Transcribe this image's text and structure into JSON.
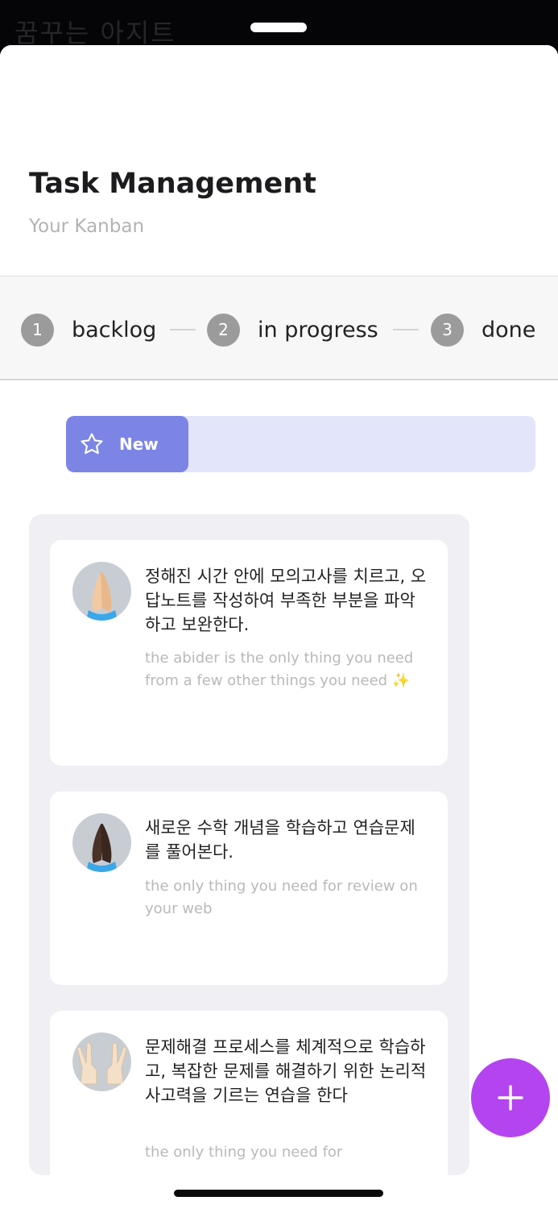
{
  "background": {
    "title": "꿈꾸는 아지트"
  },
  "header": {
    "title": "Task Management",
    "subtitle": "Your Kanban"
  },
  "stepper": {
    "steps": [
      {
        "number": "1",
        "label": "backlog"
      },
      {
        "number": "2",
        "label": "in progress"
      },
      {
        "number": "3",
        "label": "done"
      }
    ]
  },
  "filter": {
    "new_label": "New",
    "icon": "star-icon"
  },
  "cards": [
    {
      "title": "정해진 시간 안에 모의고사를 치르고, 오답노트를 작성하여 부족한 부분을 파악하고 보완한다.",
      "description": "the abider is the only thing you need from a few other things you need ✨",
      "avatar": "praying-hands-emoji"
    },
    {
      "title": "새로운 수학 개념을 학습하고 연습문제를 풀어본다.",
      "description": "the only thing you need for review on your web",
      "avatar": "praying-hands-dark-emoji"
    },
    {
      "title": "문제해결 프로세스를 체계적으로 학습하고, 복잡한 문제를 해결하기 위한 논리적 사고력을 기르는 연습을 한다",
      "description": "the only thing you need for",
      "avatar": "victory-hands-emoji"
    }
  ],
  "fab": {
    "icon": "plus-icon"
  },
  "colors": {
    "accent": "#7c85e6",
    "accent_light": "#e3e6fb",
    "fab": "#b444f0",
    "step_badge": "#9b9b9b"
  }
}
